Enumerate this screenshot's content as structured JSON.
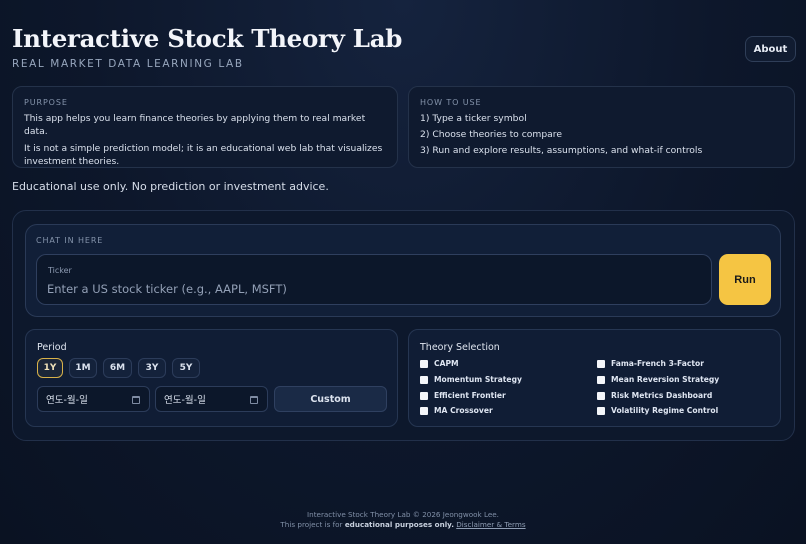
{
  "header": {
    "title": "Interactive Stock Theory Lab",
    "subtitle": "REAL MARKET DATA LEARNING LAB",
    "about_label": "About"
  },
  "purpose": {
    "heading": "PURPOSE",
    "line1": "This app helps you learn finance theories by applying them to real market data.",
    "line2": "It is not a simple prediction model; it is an educational web lab that visualizes",
    "line3": "investment theories."
  },
  "how_to_use": {
    "heading": "HOW TO USE",
    "steps": [
      "1) Type a ticker symbol",
      "2) Choose theories to compare",
      "3) Run and explore results, assumptions, and what-if controls"
    ]
  },
  "disclaimer": "Educational use only. No prediction or investment advice.",
  "chat": {
    "heading": "CHAT IN HERE",
    "ticker_label": "Ticker",
    "ticker_placeholder": "Enter a US stock ticker (e.g., AAPL, MSFT)",
    "ticker_value": "",
    "run_label": "Run"
  },
  "period": {
    "title": "Period",
    "options": [
      "1Y",
      "1M",
      "6M",
      "3Y",
      "5Y"
    ],
    "selected": "1Y",
    "start_date_placeholder": "연도-월-일",
    "end_date_placeholder": "연도-월-일",
    "custom_label": "Custom"
  },
  "theory_selection": {
    "title": "Theory Selection",
    "left": [
      "CAPM",
      "Momentum Strategy",
      "Efficient Frontier",
      "MA Crossover"
    ],
    "right": [
      "Fama-French 3-Factor",
      "Mean Reversion Strategy",
      "Risk Metrics Dashboard",
      "Volatility Regime Control"
    ],
    "checked": []
  },
  "footer": {
    "copyright": "Interactive Stock Theory Lab © 2026 Jeongwook Lee.",
    "note_prefix": "This project is for ",
    "note_bold": "educational purposes only.",
    "link_label": "Disclaimer & Terms"
  },
  "colors": {
    "accent_run": "#f5c543",
    "background": "#0d172b",
    "selected_outline": "#d8b24a"
  }
}
